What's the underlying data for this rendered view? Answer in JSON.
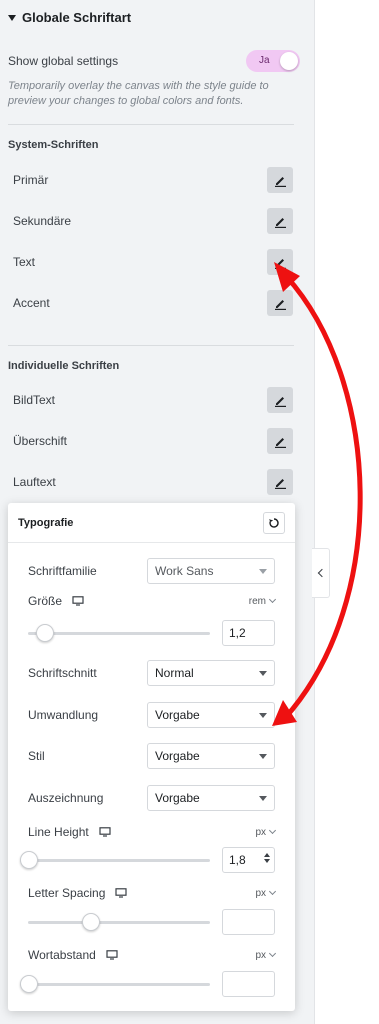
{
  "header": {
    "title": "Globale Schriftart"
  },
  "global_settings": {
    "label": "Show global settings",
    "toggle_label": "Ja",
    "description": "Temporarily overlay the canvas with the style guide to preview your changes to global colors and fonts."
  },
  "system_fonts": {
    "title": "System-Schriften",
    "items": [
      {
        "label": "Primär"
      },
      {
        "label": "Sekundäre"
      },
      {
        "label": "Text"
      },
      {
        "label": "Accent"
      }
    ]
  },
  "custom_fonts": {
    "title": "Individuelle Schriften",
    "items": [
      {
        "label": "BildText"
      },
      {
        "label": "Überschift"
      },
      {
        "label": "Lauftext"
      }
    ]
  },
  "typography": {
    "title": "Typografie",
    "font_family": {
      "label": "Schriftfamilie",
      "value": "Work Sans"
    },
    "size": {
      "label": "Größe",
      "unit": "rem",
      "value": "1,2",
      "slider_fraction": 0.05
    },
    "weight": {
      "label": "Schriftschnitt",
      "value": "Normal"
    },
    "transform": {
      "label": "Umwandlung",
      "value": "Vorgabe"
    },
    "style": {
      "label": "Stil",
      "value": "Vorgabe"
    },
    "decoration": {
      "label": "Auszeichnung",
      "value": "Vorgabe"
    },
    "line_height": {
      "label": "Line Height",
      "unit": "px",
      "value": "1,8",
      "slider_fraction": 0.0
    },
    "letter_spacing": {
      "label": "Letter Spacing",
      "unit": "px",
      "value": "",
      "slider_fraction": 0.33
    },
    "word_spacing": {
      "label": "Wortabstand",
      "unit": "px",
      "value": "",
      "slider_fraction": 0.0
    }
  },
  "colors": {
    "panel_bg": "#f1f3f5",
    "toggle_bg": "#f1c8f3",
    "arrow": "#ee1111"
  },
  "icons": {
    "edit": "pencil-icon",
    "reset": "reset-icon",
    "device": "desktop-icon",
    "collapse": "chevron-left-icon"
  }
}
